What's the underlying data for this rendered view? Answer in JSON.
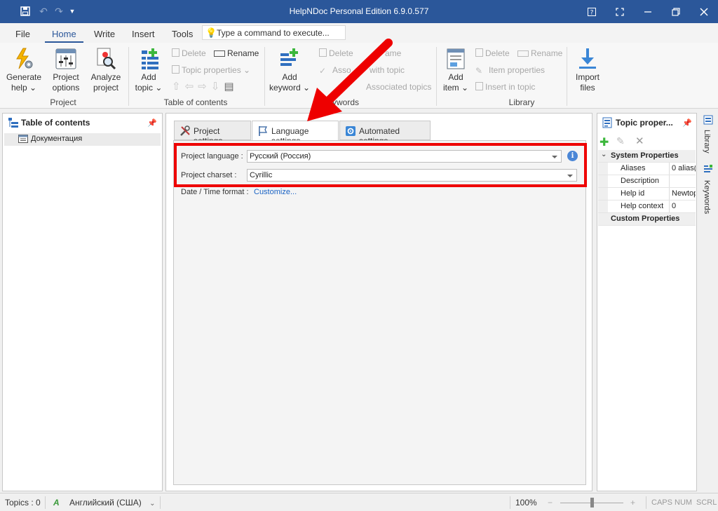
{
  "window": {
    "title": "HelpNDoc Personal Edition 6.9.0.577"
  },
  "menu": {
    "tabs": [
      "File",
      "Home",
      "Write",
      "Insert",
      "Tools"
    ],
    "active_tab": "Home",
    "command_placeholder": "Type a command to execute..."
  },
  "ribbon": {
    "project": {
      "label": "Project",
      "generate_help": [
        "Generate",
        "help"
      ],
      "project_options": [
        "Project",
        "options"
      ],
      "analyze_project": [
        "Analyze",
        "project"
      ]
    },
    "toc": {
      "label": "Table of contents",
      "add_topic": [
        "Add",
        "topic"
      ],
      "delete": "Delete",
      "rename": "Rename",
      "topic_properties": "Topic properties"
    },
    "keywords": {
      "label": "Keywords",
      "label_visible": "ywords",
      "add_keyword": [
        "Add",
        "keyword"
      ],
      "delete": "Delete",
      "rename_visible": "ame",
      "associate_visible": "Asso",
      "associate_tail": "with topic",
      "associated_topics": "Associated topics"
    },
    "library": {
      "label": "Library",
      "add_item": [
        "Add",
        "item"
      ],
      "delete": "Delete",
      "rename": "Rename",
      "item_properties": "Item properties",
      "insert_in_topic": "Insert in topic"
    },
    "import": {
      "import_files": [
        "Import",
        "files"
      ]
    }
  },
  "toc_panel": {
    "title": "Table of contents",
    "items": [
      "Документация"
    ]
  },
  "center": {
    "tabs": [
      "Project settings",
      "Language settings",
      "Automated settings"
    ],
    "active_tab": "Language settings",
    "project_language_label": "Project language :",
    "project_language_value": "Русский (Россия)",
    "project_charset_label": "Project charset :",
    "project_charset_value": "Cyrillic",
    "datetime_label": "Date / Time format :",
    "customize_link": "Customize..."
  },
  "topic_properties": {
    "title": "Topic proper...",
    "system_header": "System Properties",
    "rows": [
      {
        "key": "Aliases",
        "value": "0 alias("
      },
      {
        "key": "Description",
        "value": ""
      },
      {
        "key": "Help id",
        "value": "Newtop"
      },
      {
        "key": "Help context",
        "value": "0"
      }
    ],
    "custom_header": "Custom Properties"
  },
  "side_tabs": [
    "Library",
    "Keywords"
  ],
  "status": {
    "topics": "Topics : 0",
    "language": "Английский (США)",
    "zoom": "100%",
    "caps": "CAPS",
    "num": "NUM",
    "scrl": "SCRL"
  },
  "colors": {
    "title_bar": "#2b579a",
    "highlight": "#ee0000",
    "link": "#1a63c4"
  }
}
